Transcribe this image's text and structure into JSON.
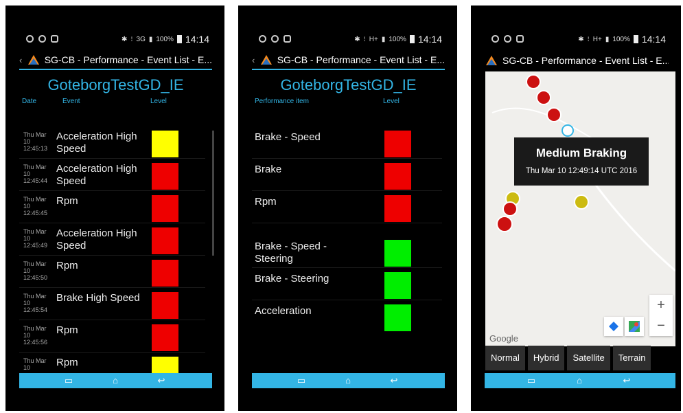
{
  "status": {
    "time": "14:14",
    "battery": "100%",
    "net1": "3G",
    "net2": "H+"
  },
  "colors": {
    "accent": "#33b5e5",
    "red": "#ee0000",
    "yellow": "#ffff00",
    "green": "#00ee00",
    "dark_red": "#cc1111"
  },
  "screen1": {
    "app_title": "SG-CB - Performance - Event List - E...",
    "test_title": "GoteborgTestGD_IE",
    "headers": {
      "date": "Date",
      "event": "Event",
      "level": "Level"
    },
    "rows": [
      {
        "date": "Thu Mar 10 12:45:13",
        "event": "Acceleration High Speed",
        "level": "yellow"
      },
      {
        "date": "Thu Mar 10 12:45:44",
        "event": "Acceleration High Speed",
        "level": "red"
      },
      {
        "date": "Thu Mar 10 12:45:45",
        "event": "Rpm",
        "level": "red"
      },
      {
        "date": "Thu Mar 10 12:45:49",
        "event": "Acceleration High Speed",
        "level": "red"
      },
      {
        "date": "Thu Mar 10 12:45:50",
        "event": "Rpm",
        "level": "red"
      },
      {
        "date": "Thu Mar 10 12:45:54",
        "event": "Brake High Speed",
        "level": "red"
      },
      {
        "date": "Thu Mar 10 12:45:56",
        "event": "Rpm",
        "level": "red"
      },
      {
        "date": "Thu Mar 10",
        "event": "Rpm",
        "level": "yellow"
      }
    ]
  },
  "screen2": {
    "app_title": "SG-CB - Performance - Event List - E...",
    "test_title": "GoteborgTestGD_IE",
    "headers": {
      "item": "Performance item",
      "level": "Level"
    },
    "rows": [
      {
        "item": "Brake - Speed",
        "level": "red"
      },
      {
        "item": "Brake",
        "level": "red"
      },
      {
        "item": "Rpm",
        "level": "red"
      },
      {
        "item": "Brake - Speed - Steering",
        "level": "green"
      },
      {
        "item": "Brake - Steering",
        "level": "green"
      },
      {
        "item": "Acceleration",
        "level": "green"
      }
    ]
  },
  "screen3": {
    "app_title": "SG-CB - Performance - Event List - E...",
    "info_title": "Medium Braking",
    "info_subtitle": "Thu Mar 10 12:49:14 UTC 2016",
    "zoom_in": "+",
    "zoom_out": "−",
    "google_label": "Google",
    "map_types": [
      "Normal",
      "Hybrid",
      "Satellite",
      "Terrain"
    ]
  },
  "icons": {
    "nav": [
      "recent-apps-icon",
      "home-icon",
      "back-icon"
    ],
    "status_left": [
      "alarm-icon",
      "clock-icon",
      "photo-icon"
    ],
    "status_right": [
      "bluetooth-icon",
      "vibrate-icon",
      "signal-icon",
      "battery-icon"
    ]
  }
}
